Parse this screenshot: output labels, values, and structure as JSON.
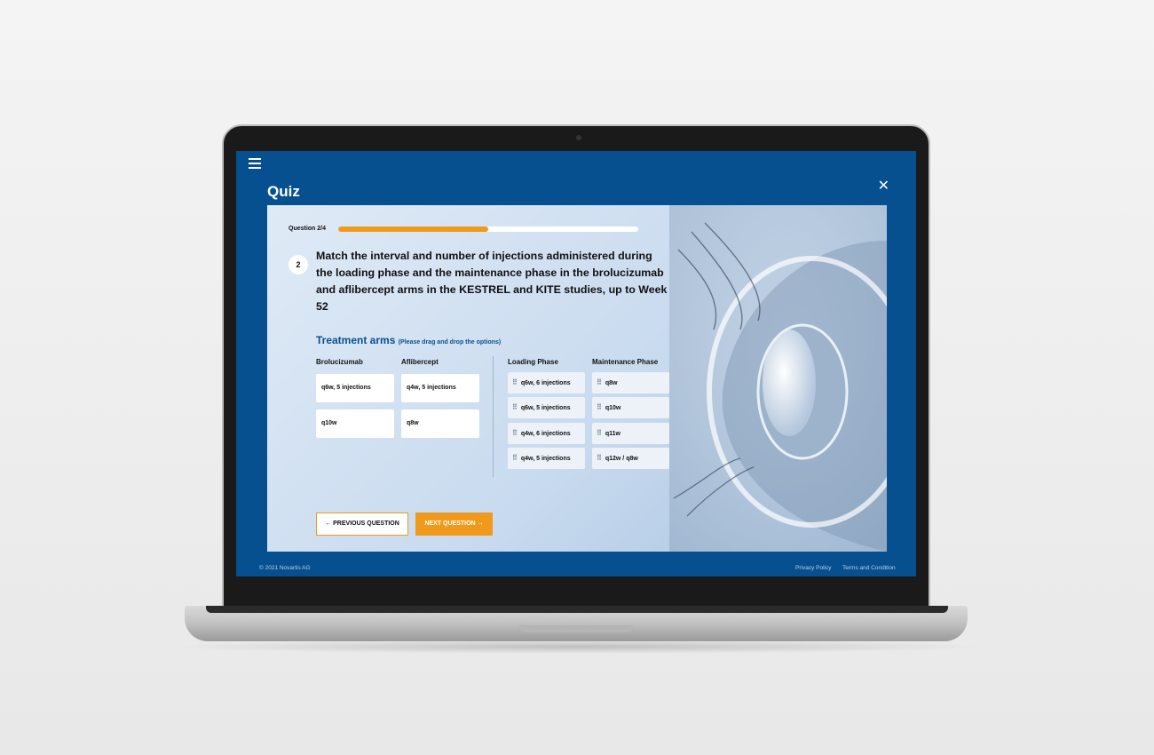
{
  "app": {
    "title": "Quiz"
  },
  "progress": {
    "label": "Question  2/4",
    "fraction": 0.5
  },
  "question": {
    "number": "2",
    "text": "Match the interval and number of injections administered during the loading phase and the maintenance phase in the brolucizumab and aflibercept arms in the KESTREL and KITE studies, up to Week 52"
  },
  "section": {
    "title": "Treatment arms",
    "hint": "(Please drag and drop the options)"
  },
  "columns": {
    "brolucizumab": "Brolucizumab",
    "aflibercept": "Aflibercept",
    "loading": "Loading Phase",
    "maintenance": "Maintenance Phase"
  },
  "drop_boxes": {
    "brolucizumab": [
      "q6w, 5 injections",
      "q10w"
    ],
    "aflibercept": [
      "q4w, 5 injections",
      "q8w"
    ]
  },
  "options": {
    "loading": [
      "q6w, 6 injections",
      "q6w, 5 injections",
      "q4w, 6 injections",
      "q4w, 5 injections"
    ],
    "maintenance": [
      "q8w",
      "q10w",
      "q11w",
      "q12w / q8w"
    ]
  },
  "buttons": {
    "previous": "← PREVIOUS QUESTION",
    "next": "NEXT QUESTION →"
  },
  "footer": {
    "copyright": "© 2021 Novartis AG",
    "privacy": "Privacy Policy",
    "terms": "Terms and Condition"
  },
  "icons": {
    "menu": "hamburger-icon",
    "close": "close-icon",
    "grip": "drag-handle-icon"
  },
  "colors": {
    "primary": "#07508f",
    "accent": "#f09a1c"
  }
}
